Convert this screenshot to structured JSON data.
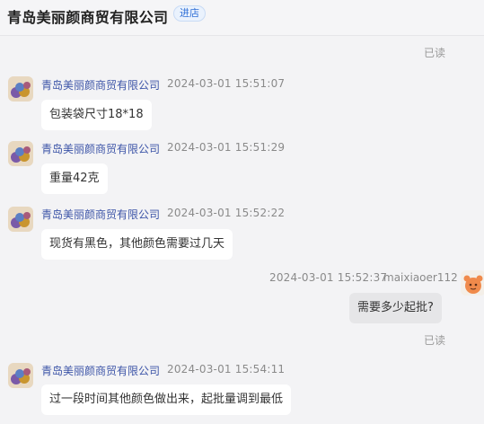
{
  "header": {
    "shop_name": "青岛美丽颜商贸有限公司",
    "enter_shop_label": "进店"
  },
  "read_label": "已读",
  "messages": [
    {
      "sender": "青岛美丽颜商贸有限公司",
      "time": "2024-03-01 15:51:07",
      "text": "包装袋尺寸18*18"
    },
    {
      "sender": "青岛美丽颜商贸有限公司",
      "time": "2024-03-01 15:51:29",
      "text": "重量42克"
    },
    {
      "sender": "青岛美丽颜商贸有限公司",
      "time": "2024-03-01 15:52:22",
      "text": "现货有黑色，其他颜色需要过几天"
    },
    {
      "sender": "maixiaoer112",
      "time": "2024-03-01 15:52:37",
      "text": "需要多少起批?",
      "mine": true,
      "status": "已读"
    },
    {
      "sender": "青岛美丽颜商贸有限公司",
      "time": "2024-03-01 15:54:11",
      "text": "过一段时间其他颜色做出来，起批量调到最低"
    }
  ],
  "colors": {
    "background": "#f3f3f5",
    "sender_name": "#3d55a8",
    "bubble": "#ffffff",
    "own_bubble": "#e6e6e8"
  }
}
